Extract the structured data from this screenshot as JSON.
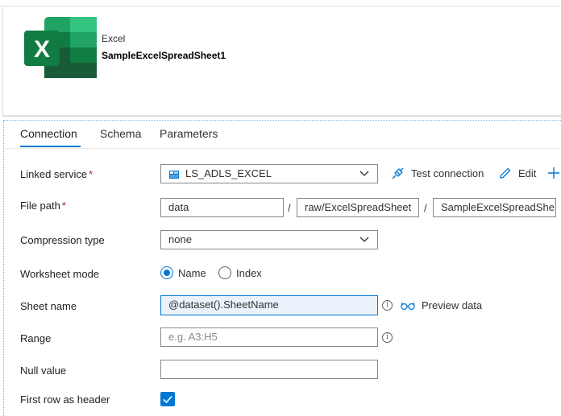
{
  "dataset": {
    "type_label": "Excel",
    "name": "SampleExcelSpreadSheet1",
    "brand_color": "#217346"
  },
  "tabs": [
    {
      "label": "Connection",
      "active": true
    },
    {
      "label": "Schema",
      "active": false
    },
    {
      "label": "Parameters",
      "active": false
    }
  ],
  "form": {
    "linked_service": {
      "label": "Linked service",
      "required_mark": "*",
      "value": "LS_ADLS_EXCEL",
      "test_connection_label": "Test connection",
      "edit_label": "Edit"
    },
    "file_path": {
      "label": "File path",
      "required_mark": "*",
      "container": "data",
      "directory": "raw/ExcelSpreadSheet",
      "file": "SampleExcelSpreadShe",
      "separator": "/"
    },
    "compression_type": {
      "label": "Compression type",
      "value": "none"
    },
    "worksheet_mode": {
      "label": "Worksheet mode",
      "options": [
        {
          "label": "Name",
          "checked": true
        },
        {
          "label": "Index",
          "checked": false
        }
      ]
    },
    "sheet_name": {
      "label": "Sheet name",
      "value": "@dataset().SheetName",
      "preview_label": "Preview data"
    },
    "range": {
      "label": "Range",
      "placeholder": "e.g. A3:H5"
    },
    "null_value": {
      "label": "Null value",
      "value": ""
    },
    "first_row_header": {
      "label": "First row as header",
      "checked": true
    }
  },
  "icons": {
    "chevron": "chevron-down-icon",
    "test_connection": "plug-icon",
    "edit": "pencil-icon",
    "add": "plus-icon",
    "info": "info-icon",
    "preview": "glasses-icon",
    "linked_service": "storage-icon",
    "checkmark": "checkmark-icon"
  },
  "colors": {
    "accent": "#0078d4",
    "required": "#a4262c"
  }
}
